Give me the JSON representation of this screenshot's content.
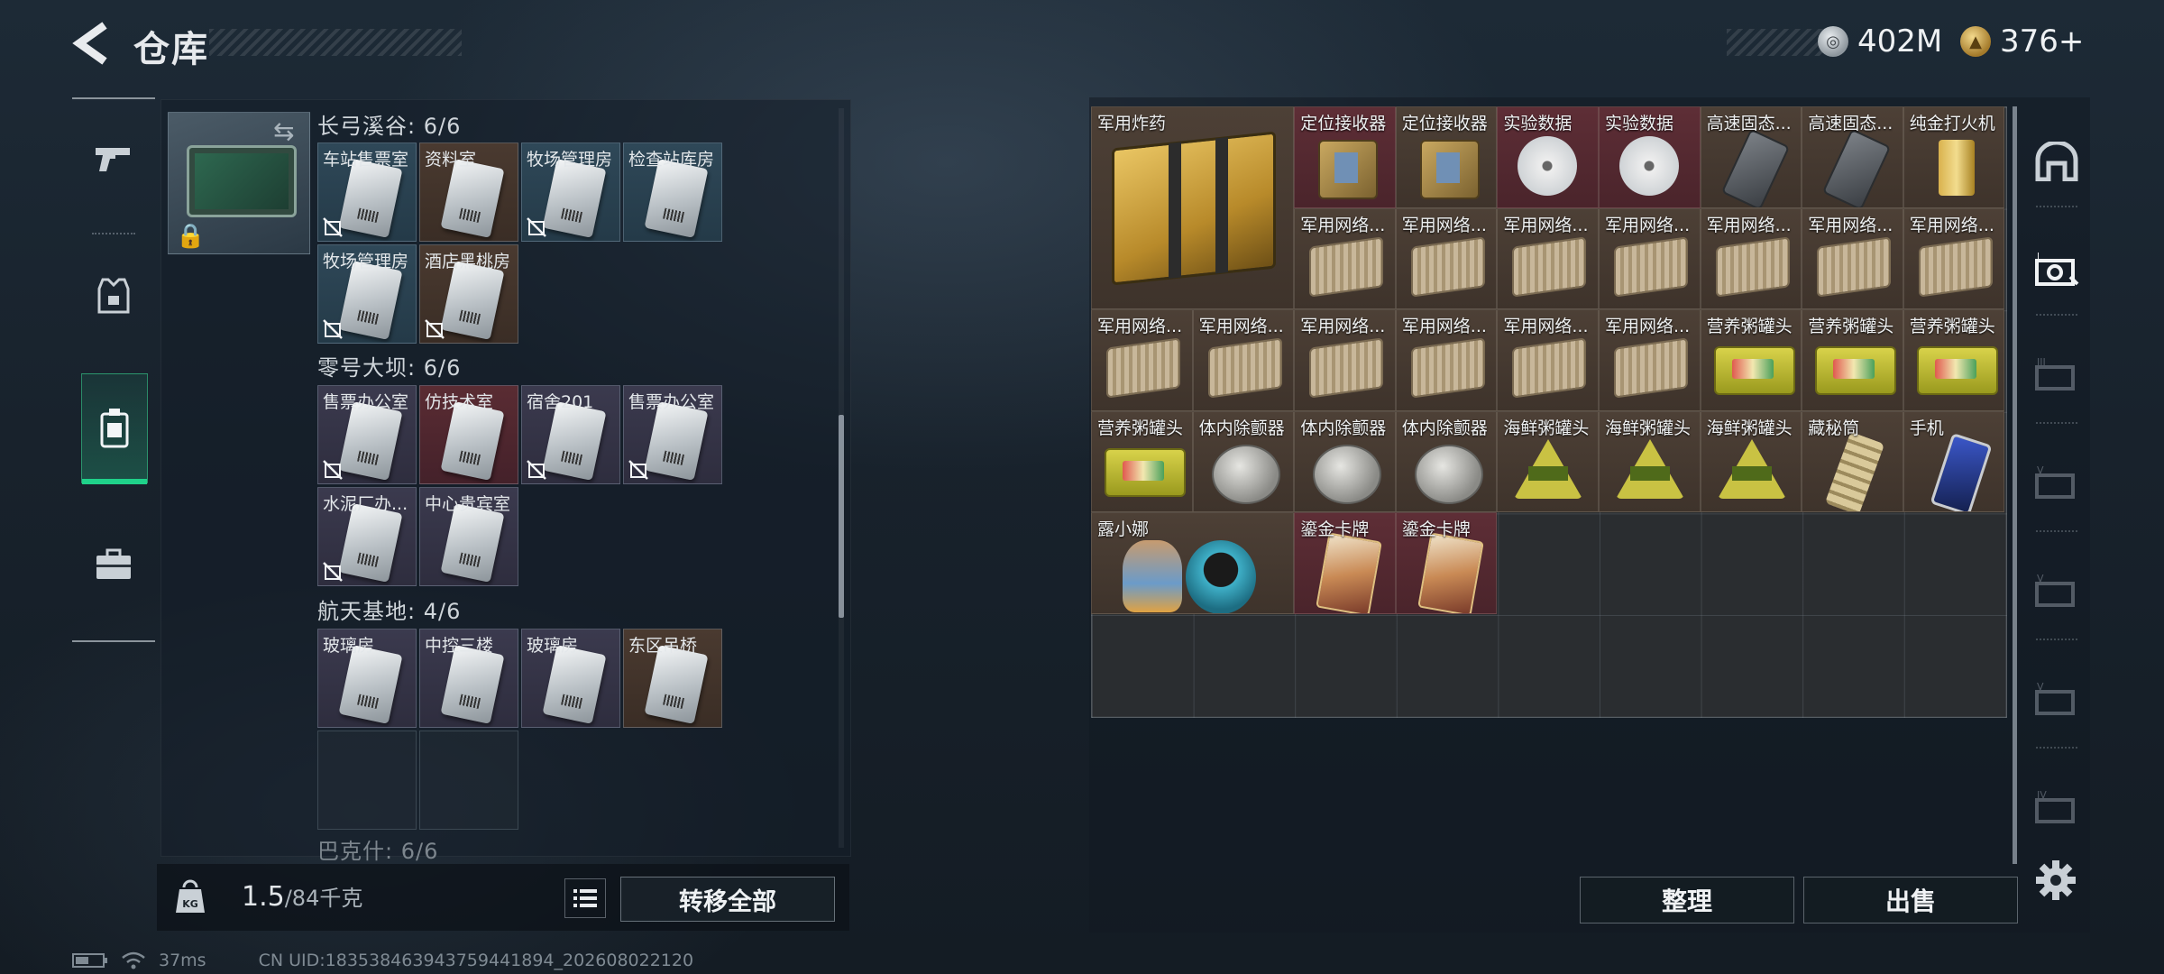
{
  "header": {
    "title": "仓库",
    "currency": [
      {
        "name": "silver-coin",
        "amount": "402M",
        "color": "#c7ccd0"
      },
      {
        "name": "gold-coin",
        "amount": "376+",
        "color": "#d9b04a"
      }
    ]
  },
  "left_rail": {
    "items": [
      {
        "icon": "gun-icon"
      },
      {
        "icon": "armor-icon"
      },
      {
        "icon": "key-case-icon",
        "active": true
      },
      {
        "icon": "briefcase-icon"
      }
    ],
    "accent": "#1fd28a"
  },
  "key_case": {
    "sections": [
      {
        "name": "长弓溪谷: 6/6"
      },
      {
        "name": "零号大坝: 6/6"
      },
      {
        "name": "航天基地: 4/6"
      },
      {
        "name": "巴克什: 6/6"
      }
    ],
    "cells": [
      {
        "label": "车站售票室"
      },
      {
        "label": "资料室"
      },
      {
        "label": "牧场管理房"
      },
      {
        "label": "检查站库房"
      },
      {
        "label": "牧场管理房"
      },
      {
        "label": "酒店黑桃房"
      },
      {
        "label": "售票办公室"
      },
      {
        "label": "仿技术室"
      },
      {
        "label": "宿舍201"
      },
      {
        "label": "售票办公室"
      },
      {
        "label": "水泥厂办..."
      },
      {
        "label": "中心贵宾室"
      },
      {
        "label": "玻璃房"
      },
      {
        "label": "中控三楼"
      },
      {
        "label": "玻璃房"
      },
      {
        "label": "东区吊桥"
      }
    ]
  },
  "weight": {
    "current": "1.5",
    "max": "/84千克"
  },
  "buttons": {
    "transfer_all": "转移全部",
    "sort": "整理",
    "sell": "出售"
  },
  "status_bar": {
    "ping": "37ms",
    "uid": "CN UID:1835384639437594418​94_202608022120"
  },
  "storage": {
    "items": [
      {
        "label": "军用炸药"
      },
      {
        "label": "定位接收器"
      },
      {
        "label": "定位接收器"
      },
      {
        "label": "实验数据"
      },
      {
        "label": "实验数据"
      },
      {
        "label": "高速固态..."
      },
      {
        "label": "高速固态..."
      },
      {
        "label": "纯金打火机"
      },
      {
        "label": "军用网络..."
      },
      {
        "label": "军用网络..."
      },
      {
        "label": "军用网络..."
      },
      {
        "label": "军用网络..."
      },
      {
        "label": "军用网络..."
      },
      {
        "label": "军用网络..."
      },
      {
        "label": "军用网络..."
      },
      {
        "label": "军用网络..."
      },
      {
        "label": "军用网络..."
      },
      {
        "label": "军用网络..."
      },
      {
        "label": "军用网络..."
      },
      {
        "label": "军用网络..."
      },
      {
        "label": "军用网络..."
      },
      {
        "label": "营养粥罐头"
      },
      {
        "label": "营养粥罐头"
      },
      {
        "label": "营养粥罐头"
      },
      {
        "label": "营养粥罐头"
      },
      {
        "label": "体内除颤器"
      },
      {
        "label": "体内除颤器"
      },
      {
        "label": "体内除颤器"
      },
      {
        "label": "海鲜粥罐头"
      },
      {
        "label": "海鲜粥罐头"
      },
      {
        "label": "海鲜粥罐头"
      },
      {
        "label": "藏秘筒"
      },
      {
        "label": "手机"
      },
      {
        "label": "露小娜"
      },
      {
        "label": "鎏金卡牌"
      },
      {
        "label": "鎏金卡牌"
      }
    ]
  },
  "right_rail": {
    "items": [
      {
        "icon": "storage-main-icon"
      },
      {
        "icon": "storage-tab-icon",
        "active": true
      },
      {
        "icon": "storage-tab-3-icon",
        "text": "III"
      },
      {
        "icon": "storage-tab-5-icon",
        "text": "V"
      },
      {
        "icon": "storage-tab-5b-icon",
        "text": "V"
      },
      {
        "icon": "storage-tab-5c-icon",
        "text": "V"
      },
      {
        "icon": "storage-tab-4-icon",
        "text": "IV"
      }
    ]
  }
}
